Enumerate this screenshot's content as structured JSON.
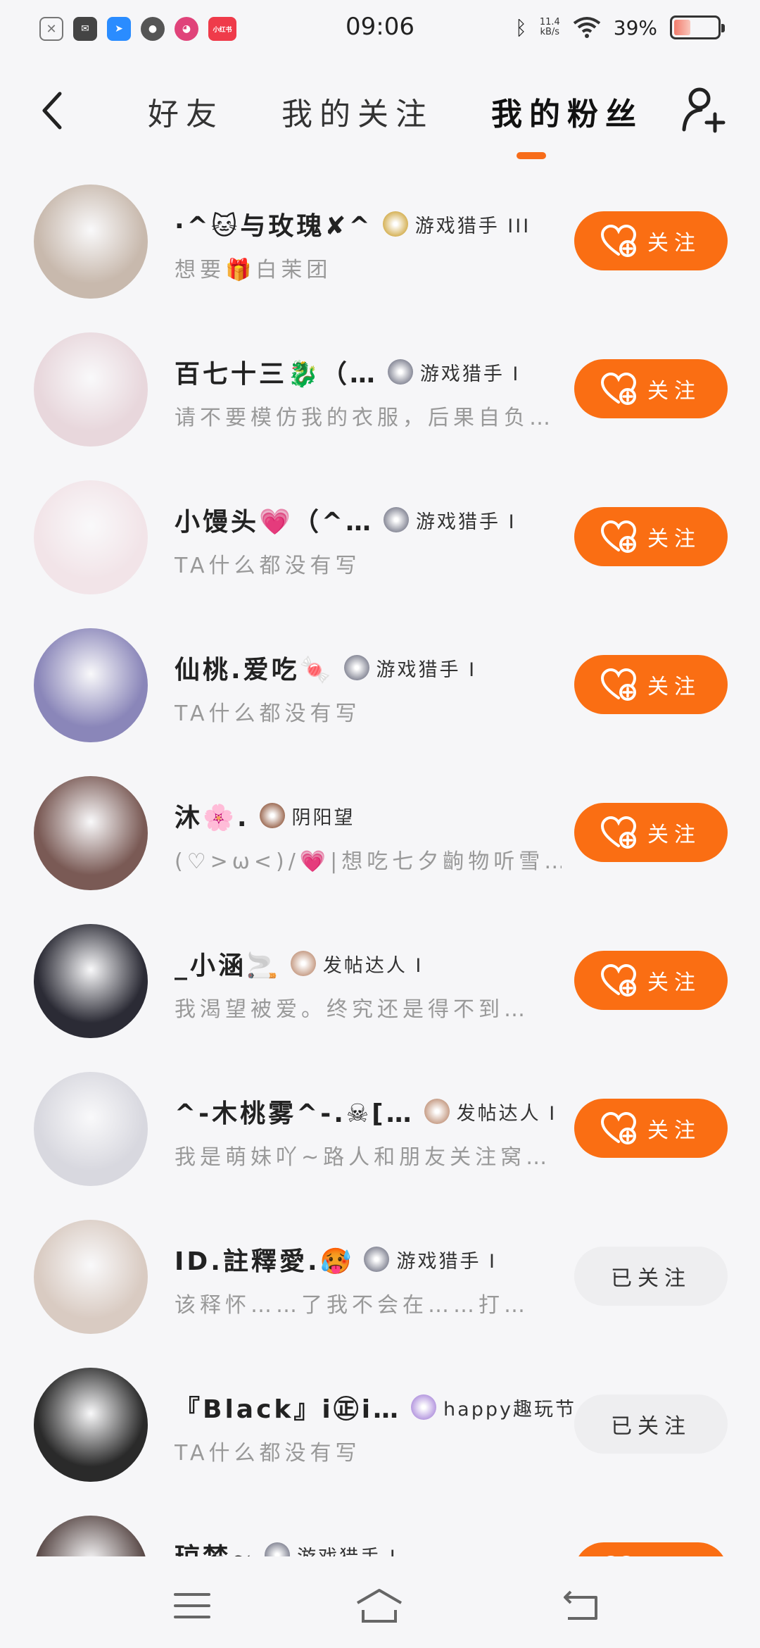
{
  "status_bar": {
    "time": "09:06",
    "net_speed_value": "11.4",
    "net_speed_unit": "kB/s",
    "battery": "39%",
    "battery_level": 0.39,
    "apps": [
      {
        "icon": "notification-blocked-icon",
        "color": "#777777"
      },
      {
        "icon": "mail-icon",
        "color": "#444444"
      },
      {
        "icon": "dingtalk-icon",
        "color": "#2a8cff"
      },
      {
        "icon": "flame-app-icon",
        "color": "#555555"
      },
      {
        "icon": "chat-app-icon",
        "color": "#e0437a"
      },
      {
        "icon": "xiaohongshu-icon",
        "color": "#ef3b4a",
        "label": "小红书"
      }
    ]
  },
  "header": {
    "tabs": [
      {
        "label": "好友",
        "active": false
      },
      {
        "label": "我的关注",
        "active": false
      },
      {
        "label": "我的粉丝",
        "active": true
      }
    ]
  },
  "accent_color": "#fa6e13",
  "fans": [
    {
      "name": "·^🐱与玫瑰✘^",
      "badge": "游戏猎手 III",
      "badge_color": "#d6b35a",
      "bio": "想要🎁白茉团",
      "button": "关注",
      "followed": false,
      "avatar_color": "#c8b9ad"
    },
    {
      "name": "百七十三🐉（…",
      "badge": "游戏猎手 I",
      "badge_color": "#8a8c9a",
      "bio": "请不要模仿我的衣服，后果自负…",
      "button": "关注",
      "followed": false,
      "avatar_color": "#e8d7dc"
    },
    {
      "name": "小馒头💗（^…",
      "badge": "游戏猎手 I",
      "badge_color": "#8a8c9a",
      "bio": "TA什么都没有写",
      "button": "关注",
      "followed": false,
      "avatar_color": "#f2e4e8"
    },
    {
      "name": "仙桃.爱吃🍬",
      "badge": "游戏猎手 I",
      "badge_color": "#8a8c9a",
      "bio": "TA什么都没有写",
      "button": "关注",
      "followed": false,
      "avatar_color": "#8a86b9"
    },
    {
      "name": "沐🌸.",
      "badge": "阴阳望",
      "badge_color": "#a0705a",
      "bio": "(♡>ω<)/💗|想吃七夕齣物听雪…",
      "button": "关注",
      "followed": false,
      "avatar_color": "#7a5a55"
    },
    {
      "name": "_小涵🚬",
      "badge": "发帖达人 I",
      "badge_color": "#c8a08a",
      "bio": "我渴望被爱。终究还是得不到…",
      "button": "关注",
      "followed": false,
      "avatar_color": "#2b2b35"
    },
    {
      "name": "^-木桃雾^-.☠[…",
      "badge": "发帖达人 I",
      "badge_color": "#c8a08a",
      "bio": "我是萌妹吖~路人和朋友关注窝…",
      "button": "关注",
      "followed": false,
      "avatar_color": "#d8d8df"
    },
    {
      "name": "ID.註釋愛.🥵",
      "badge": "游戏猎手 I",
      "badge_color": "#8a8c9a",
      "bio": "该释怀……了我不会在……打…",
      "button": "已关注",
      "followed": true,
      "avatar_color": "#d9cbc2"
    },
    {
      "name": "『Black』i㊣i…",
      "badge": "happy趣玩节",
      "badge_color": "#b79be0",
      "bio": "TA什么都没有写",
      "button": "已关注",
      "followed": true,
      "avatar_color": "#2a2a2a"
    },
    {
      "name": "琼梦~",
      "badge": "游戏猎手 I",
      "badge_color": "#8a8c9a",
      "bio": "",
      "button": "关注",
      "followed": false,
      "avatar_color": "#5a4a48"
    }
  ],
  "nav": {
    "items": [
      "menu-icon",
      "home-icon",
      "back-icon"
    ]
  }
}
